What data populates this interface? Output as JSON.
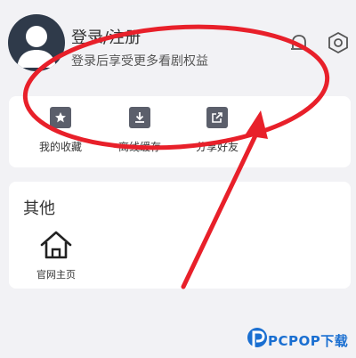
{
  "header": {
    "title": "登录/注册",
    "subtitle": "登录后享受更多看剧权益"
  },
  "actions": [
    {
      "label": "我的收藏",
      "icon": "star-icon"
    },
    {
      "label": "离线缓存",
      "icon": "download-icon"
    },
    {
      "label": "分享好友",
      "icon": "share-icon"
    }
  ],
  "other": {
    "title": "其他",
    "items": [
      {
        "label": "官网主页",
        "icon": "home-icon"
      }
    ]
  },
  "watermark": {
    "text": "PCPOP下载"
  },
  "colors": {
    "annotation": "#e8202a",
    "icon": "#5b5f6b",
    "watermark": "#1a6fd1"
  }
}
